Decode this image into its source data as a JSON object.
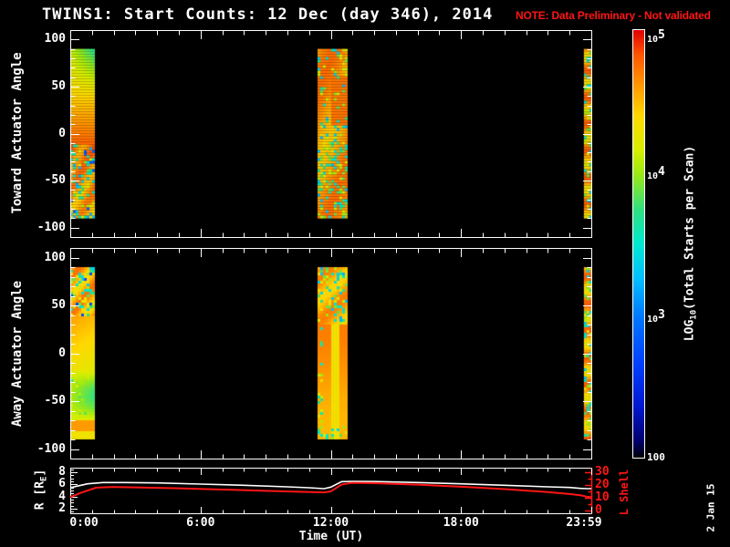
{
  "title": {
    "main": "TWINS1: Start Counts: 12 Dec (day 346), 2014",
    "note": "NOTE: Data Preliminary - Not validated"
  },
  "date_stamp": "2 Jan 15",
  "colors": {
    "background": "#000000",
    "foreground": "#ffffff",
    "alert_red": "#ff1515",
    "colormap_stops": [
      [
        0.0,
        "#000008"
      ],
      [
        0.04,
        "#000070"
      ],
      [
        0.12,
        "#0018d0"
      ],
      [
        0.22,
        "#0040ff"
      ],
      [
        0.33,
        "#0078ff"
      ],
      [
        0.42,
        "#00c0ff"
      ],
      [
        0.5,
        "#00e8d0"
      ],
      [
        0.58,
        "#30e080"
      ],
      [
        0.66,
        "#98e818"
      ],
      [
        0.72,
        "#d8ee00"
      ],
      [
        0.8,
        "#ffd800"
      ],
      [
        0.87,
        "#ff9800"
      ],
      [
        0.94,
        "#ff5800"
      ],
      [
        1.0,
        "#e00000"
      ]
    ]
  },
  "xaxis": {
    "label": "Time (UT)",
    "tick_labels": [
      "0:00",
      "6:00",
      "12:00",
      "18:00",
      "23:59"
    ],
    "tick_hours": [
      0,
      6,
      12,
      18,
      24
    ]
  },
  "panels": {
    "toward": {
      "ylabel": "Toward Actuator Angle",
      "ytick_labels": [
        "100",
        "50",
        "0",
        "-50",
        "-100"
      ],
      "ytick_values": [
        100,
        50,
        0,
        -50,
        -100
      ]
    },
    "away": {
      "ylabel": "Away Actuator Angle",
      "ytick_labels": [
        "100",
        "50",
        "0",
        "-50",
        "-100"
      ],
      "ytick_values": [
        100,
        50,
        0,
        -50,
        -100
      ]
    },
    "ephemeris": {
      "left_label_pre": "R [R",
      "left_label_sub": "E",
      "left_label_post": "]",
      "left_tick_labels": [
        "8",
        "6",
        "4",
        "2"
      ],
      "left_tick_values": [
        8,
        6,
        4,
        2
      ],
      "right_label": "L Shell",
      "right_tick_labels": [
        "30",
        "20",
        "10",
        "0"
      ],
      "right_tick_values": [
        30,
        20,
        10,
        0
      ]
    }
  },
  "colorbar": {
    "label_pre": "LOG",
    "label_sub": "10",
    "label_post": "(Total Starts per Scan)",
    "ticks": [
      {
        "base": "10",
        "sup": "5",
        "frac": 0
      },
      {
        "base": "10",
        "sup": "4",
        "frac": 0.3333
      },
      {
        "base": "10",
        "sup": "3",
        "frac": 0.6667
      },
      {
        "base": "100",
        "sup": "",
        "frac": 1
      }
    ]
  },
  "chart_data": [
    {
      "type": "heatmap",
      "name": "toward_actuator_spectrogram",
      "ylabel": "Toward Actuator Angle",
      "xlabel": "Time (UT)",
      "x_range_hours": [
        0,
        24
      ],
      "y_range": [
        -110,
        110
      ],
      "angle_coverage": [
        -90,
        90
      ],
      "color_scale": "log10(Total Starts per Scan)",
      "color_range_log10": [
        2,
        5
      ],
      "data_intervals": [
        {
          "start_hour": 0.0,
          "end_hour": 1.05,
          "description": "full angle sweep; green-yellow near +90 (log10~3.7-4.1), orange-red from +60 to -10 (log10~4.5-4.8), speckled orange/yellow with cyan-blue flecks below -10"
        },
        {
          "start_hour": 11.39,
          "end_hour": 12.69,
          "description": "full angle sweep; mottled orange-yellow with curved streaks and cyan/blue flecks, solid red-orange patch in upper middle; log10~4.4-4.8"
        },
        {
          "start_hour": 23.66,
          "end_hour": 24.0,
          "description": "narrow stripe; alternating orange/red/yellow cells with cyan segments; log10~3.5-4.7"
        }
      ]
    },
    {
      "type": "heatmap",
      "name": "away_actuator_spectrogram",
      "ylabel": "Away Actuator Angle",
      "xlabel": "Time (UT)",
      "x_range_hours": [
        0,
        24
      ],
      "y_range": [
        -110,
        110
      ],
      "angle_coverage": [
        -90,
        90
      ],
      "color_scale": "log10(Total Starts per Scan)",
      "color_range_log10": [
        2,
        5
      ],
      "data_intervals": [
        {
          "start_hour": 0.0,
          "end_hour": 1.05,
          "description": "speckled red-orange with cyan flecks above +40, smooth orange fading to yellow 0 to -40, greenish patch near -55 to -75, orange band near -85; log10~3.8-4.8"
        },
        {
          "start_hour": 11.39,
          "end_hour": 12.69,
          "description": "speckled upper third, solid orange below with yellow vertical band; cyan flecks at left edge and bottom; log10~4.3-4.8"
        },
        {
          "start_hour": 23.66,
          "end_hour": 24.0,
          "description": "narrow stripe; alternating orange/red cells with cyan segments; log10~3.5-4.7"
        }
      ]
    },
    {
      "type": "line",
      "name": "spacecraft_ephemeris",
      "xlabel": "Time (UT)",
      "x_range_hours": [
        0,
        24
      ],
      "series": [
        {
          "name": "R [RE]",
          "color": "#ffffff",
          "axis": "left",
          "axis_ticks": [
            2,
            4,
            6,
            8
          ],
          "x_hours": [
            0,
            0.3,
            0.8,
            1.5,
            2.5,
            4,
            6,
            8,
            10,
            11,
            11.7,
            12,
            12.5,
            13,
            14,
            16,
            18,
            20,
            22,
            23,
            23.5,
            23.8,
            24
          ],
          "values": [
            5.45,
            5.7,
            6.1,
            6.3,
            6.3,
            6.25,
            6.05,
            5.85,
            5.6,
            5.45,
            5.3,
            5.55,
            6.45,
            6.5,
            6.48,
            6.3,
            6.1,
            5.85,
            5.6,
            5.5,
            5.35,
            5.3,
            5.3
          ]
        },
        {
          "name": "L Shell",
          "color": "#ff1515",
          "axis": "right",
          "axis_ticks": [
            0,
            10,
            20,
            30
          ],
          "x_hours": [
            0,
            0.5,
            1.2,
            2,
            3,
            5,
            7,
            9,
            10.5,
            11.7,
            12,
            12.5,
            13,
            14,
            16,
            18,
            20,
            22,
            23,
            23.5,
            23.8,
            24
          ],
          "values": [
            10.5,
            14,
            18,
            18.5,
            18.2,
            17.5,
            16.5,
            15.5,
            14.8,
            14.2,
            15,
            20.5,
            21.8,
            21.5,
            20.3,
            18.7,
            16.8,
            14.5,
            13,
            12,
            10.8,
            10.5
          ]
        }
      ]
    }
  ]
}
